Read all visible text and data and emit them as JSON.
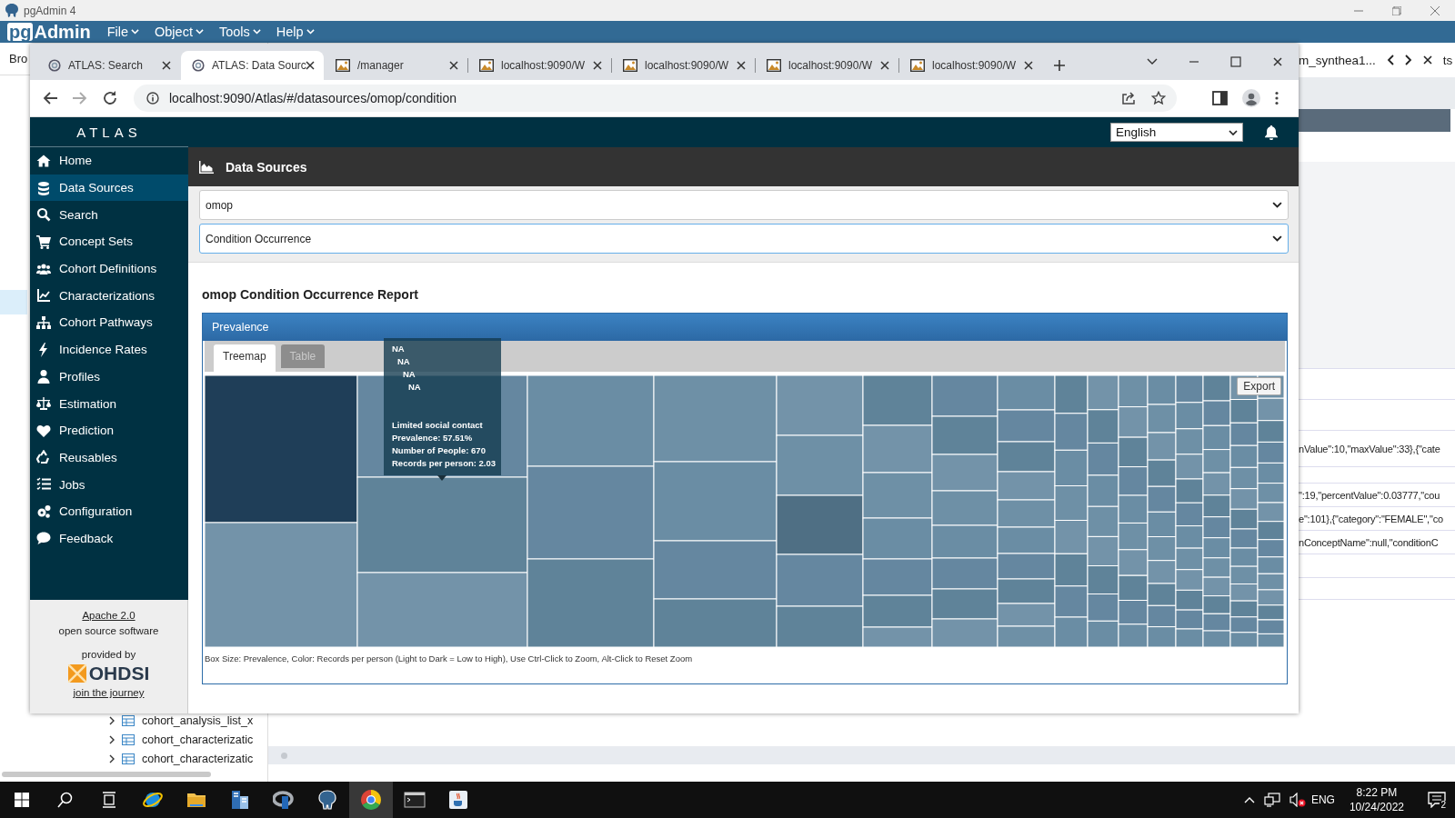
{
  "pgadmin": {
    "title": "pgAdmin 4",
    "logo_pg": "pg",
    "logo_admin": "Admin",
    "menus": [
      "File",
      "Object",
      "Tools",
      "Help"
    ],
    "browser_tab": "Bro",
    "query_tab": "m_synthea1...",
    "tab_tail": "ts",
    "result_lines": [
      "nValue\":10,\"maxValue\":33},{\"cate",
      "\":19,\"percentValue\":0.03777,\"cou",
      "e\":101},{\"category\":\"FEMALE\",\"co",
      "nConceptName\":null,\"conditionC"
    ],
    "tree_items": [
      "cohort_analysis_list_x",
      "cohort_characterizatic",
      "cohort_characterizatic"
    ]
  },
  "browser": {
    "tabs": [
      {
        "title": "ATLAS: Search",
        "kind": "site",
        "selected": false
      },
      {
        "title": "ATLAS: Data Sourc",
        "kind": "site",
        "selected": true
      },
      {
        "title": "/manager",
        "kind": "image",
        "selected": false
      },
      {
        "title": "localhost:9090/W",
        "kind": "image",
        "selected": false
      },
      {
        "title": "localhost:9090/W",
        "kind": "image",
        "selected": false
      },
      {
        "title": "localhost:9090/W",
        "kind": "image",
        "selected": false
      },
      {
        "title": "localhost:9090/W",
        "kind": "image",
        "selected": false
      }
    ],
    "url": "localhost:9090/Atlas/#/datasources/omop/condition"
  },
  "atlas": {
    "brand": "ATLAS",
    "language": "English",
    "nav": [
      {
        "label": "Home",
        "selected": false
      },
      {
        "label": "Data Sources",
        "selected": true
      },
      {
        "label": "Search",
        "selected": false
      },
      {
        "label": "Concept Sets",
        "selected": false
      },
      {
        "label": "Cohort Definitions",
        "selected": false
      },
      {
        "label": "Characterizations",
        "selected": false
      },
      {
        "label": "Cohort Pathways",
        "selected": false
      },
      {
        "label": "Incidence Rates",
        "selected": false
      },
      {
        "label": "Profiles",
        "selected": false
      },
      {
        "label": "Estimation",
        "selected": false
      },
      {
        "label": "Prediction",
        "selected": false
      },
      {
        "label": "Reusables",
        "selected": false
      },
      {
        "label": "Jobs",
        "selected": false
      },
      {
        "label": "Configuration",
        "selected": false
      },
      {
        "label": "Feedback",
        "selected": false
      }
    ],
    "footer": {
      "license": "Apache 2.0",
      "license_note": "open source software",
      "provided_by": "provided by",
      "org": "OHDSI",
      "join": "join the journey"
    },
    "page_title": "Data Sources",
    "source_select": "omop",
    "report_select": "Condition Occurrence",
    "report_title": "omop Condition Occurrence Report",
    "panel": {
      "title": "Prevalence",
      "tabs": [
        {
          "label": "Treemap",
          "selected": true
        },
        {
          "label": "Table",
          "selected": false
        }
      ],
      "export": "Export",
      "caption": "Box Size: Prevalence, Color: Records per person (Light to Dark = Low to High), Use Ctrl-Click to Zoom, Alt-Click to Reset Zoom",
      "tooltip": {
        "path": [
          "NA",
          "NA",
          "NA",
          "NA"
        ],
        "lines": [
          "Limited social contact",
          "Prevalence: 57.51%",
          "Number of People: 670",
          "Records per person: 2.03"
        ]
      }
    }
  },
  "taskbar": {
    "apps": [
      {
        "selected": false
      },
      {
        "selected": false
      },
      {
        "selected": false
      },
      {
        "selected": false
      },
      {
        "selected": false
      },
      {
        "selected": true
      },
      {
        "selected": false
      },
      {
        "selected": false
      }
    ],
    "language": "ENG",
    "time": "8:22 PM",
    "date": "10/24/2022",
    "notifications": "2"
  }
}
